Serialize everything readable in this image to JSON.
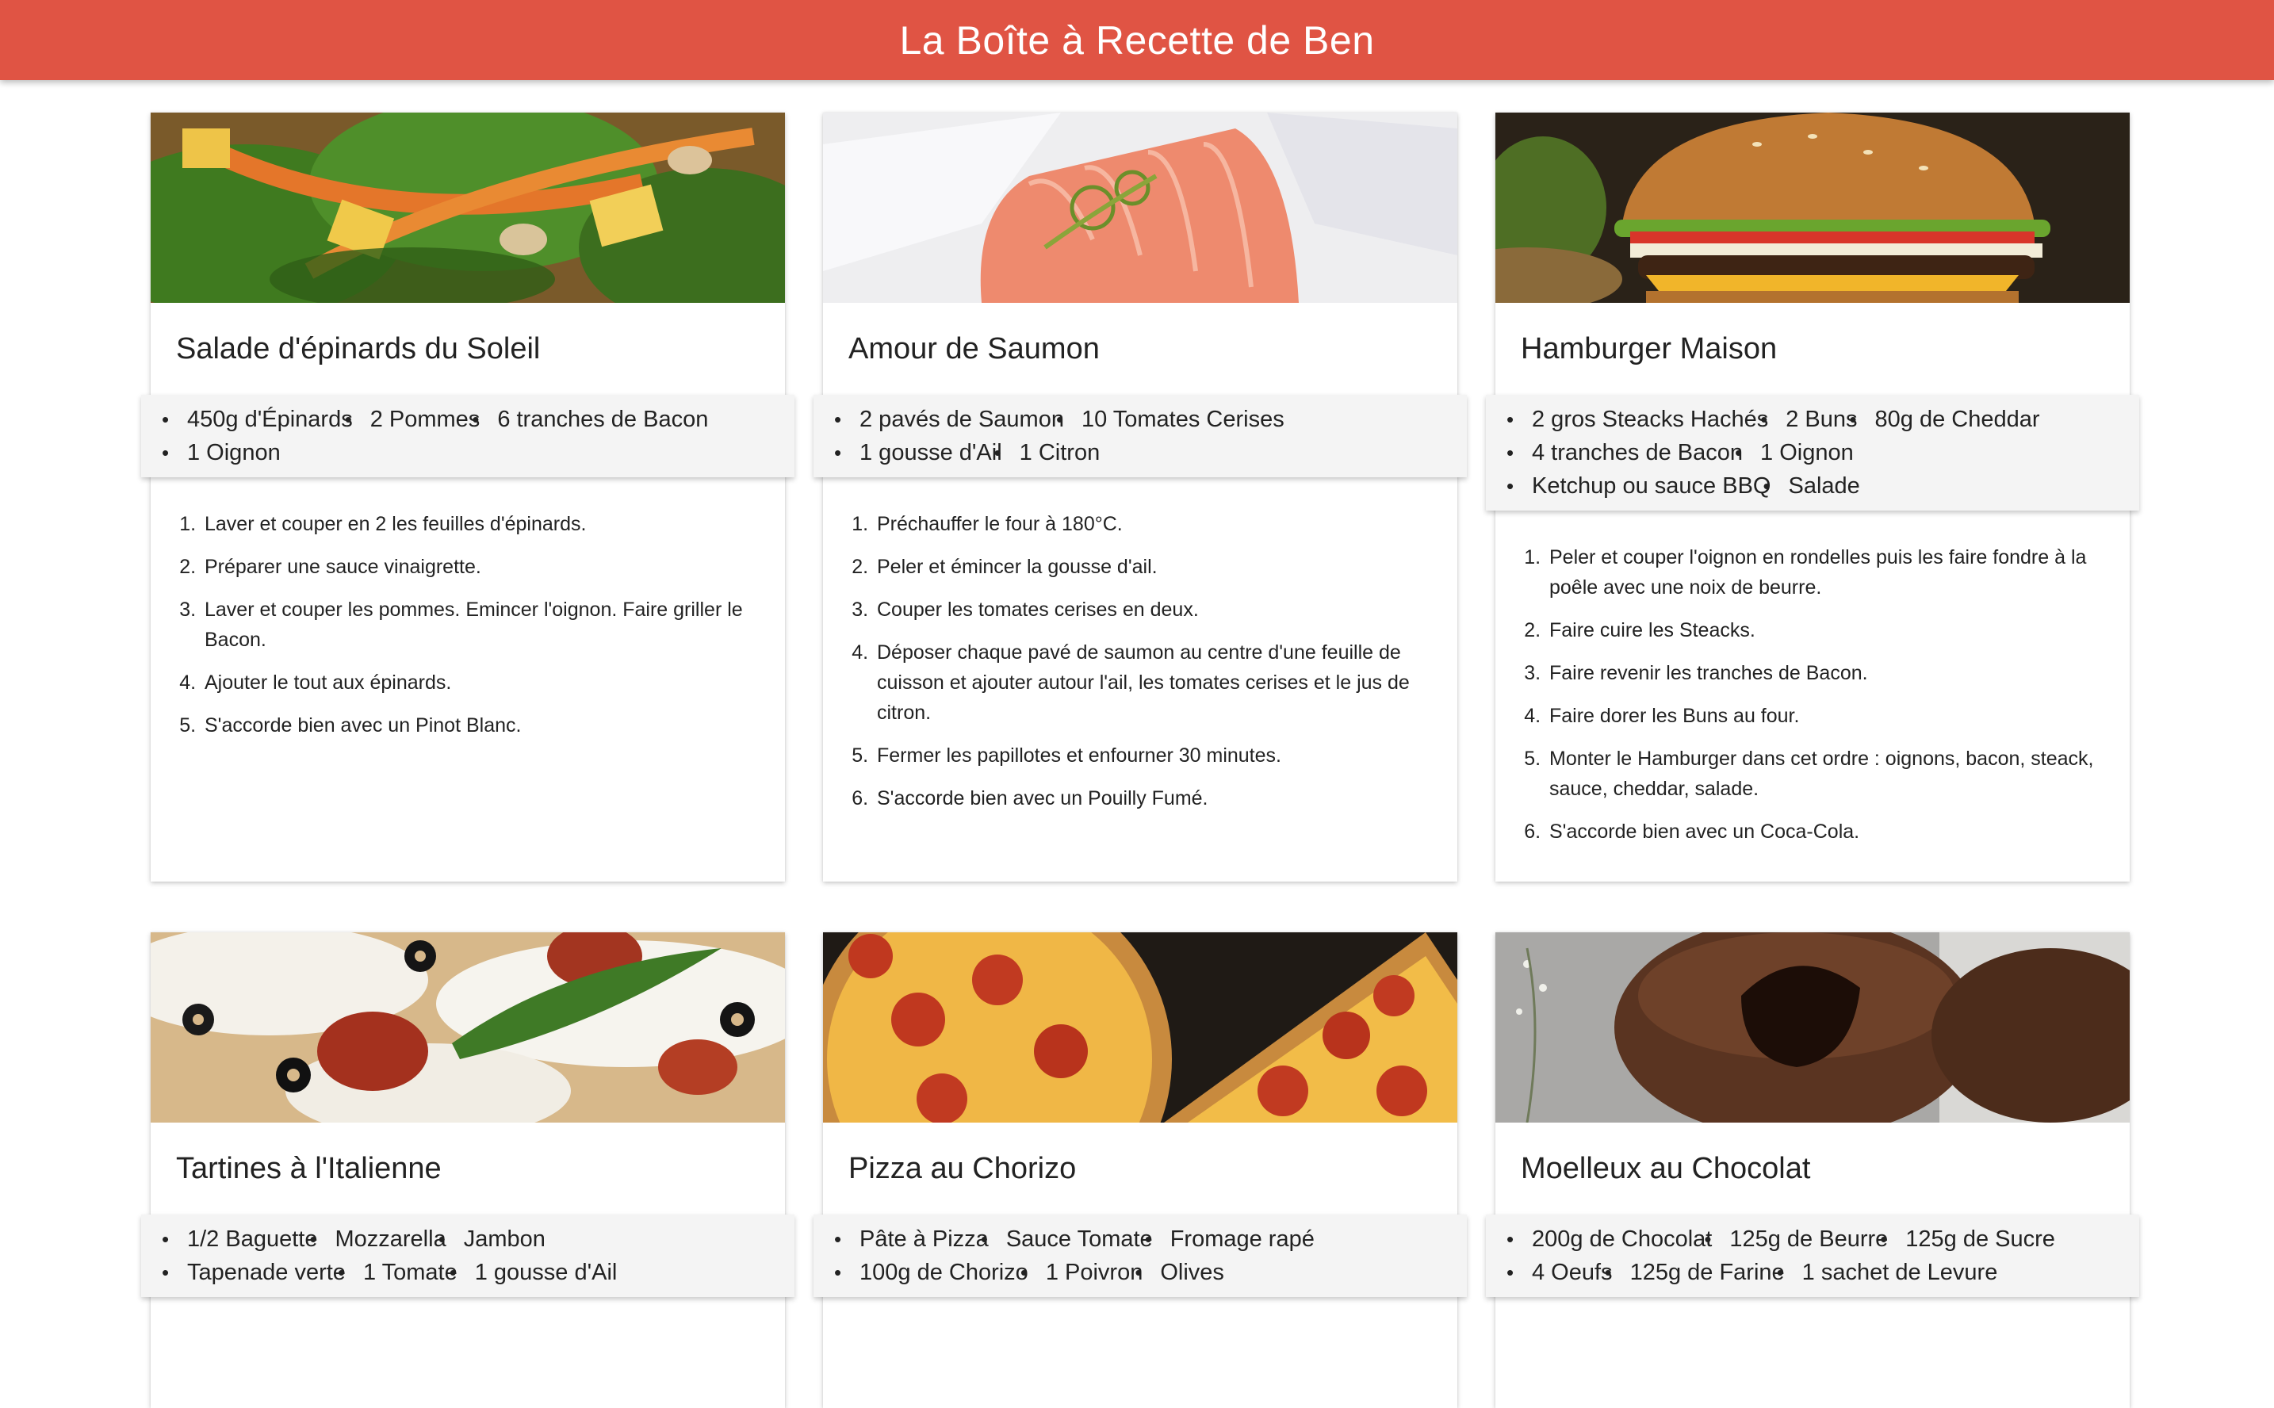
{
  "header": {
    "title": "La Boîte à Recette de Ben"
  },
  "recipes": [
    {
      "title": "Salade d'épinards du Soleil",
      "image": "spinach-salad-image",
      "ingredient_lines": [
        [
          "450g d'Épinards",
          "2 Pommes",
          "6 tranches de Bacon"
        ],
        [
          "1 Oignon"
        ]
      ],
      "steps": [
        "Laver et couper en 2 les feuilles d'épinards.",
        "Préparer une sauce vinaigrette.",
        "Laver et couper les pommes. Emincer l'oignon. Faire griller le Bacon.",
        "Ajouter le tout aux épinards.",
        "S'accorde bien avec un Pinot Blanc."
      ]
    },
    {
      "title": "Amour de Saumon",
      "image": "salmon-image",
      "ingredient_lines": [
        [
          "2 pavés de Saumon",
          "10 Tomates Cerises"
        ],
        [
          "1 gousse d'Ail",
          "1 Citron"
        ]
      ],
      "steps": [
        "Préchauffer le four à 180°C.",
        "Peler et émincer la gousse d'ail.",
        "Couper les tomates cerises en deux.",
        "Déposer chaque pavé de saumon au centre d'une feuille de cuisson et ajouter autour l'ail, les tomates cerises et le jus de citron.",
        "Fermer les papillotes et enfourner 30 minutes.",
        "S'accorde bien avec un Pouilly Fumé."
      ]
    },
    {
      "title": "Hamburger Maison",
      "image": "hamburger-image",
      "ingredient_lines": [
        [
          "2 gros Steacks Hachés",
          "2 Buns",
          "80g de Cheddar"
        ],
        [
          "4 tranches de Bacon",
          "1 Oignon"
        ],
        [
          "Ketchup ou sauce BBQ",
          "Salade"
        ]
      ],
      "steps": [
        "Peler et couper l'oignon en rondelles puis les faire fondre à la poêle avec une noix de beurre.",
        "Faire cuire les Steacks.",
        "Faire revenir les tranches de Bacon.",
        "Faire dorer les Buns au four.",
        "Monter le Hamburger dans cet ordre : oignons, bacon, steack, sauce, cheddar, salade.",
        "S'accorde bien avec un Coca-Cola."
      ]
    },
    {
      "title": "Tartines à l'Italienne",
      "image": "tartines-image",
      "ingredient_lines": [
        [
          "1/2 Baguette",
          "Mozzarella",
          "Jambon"
        ],
        [
          "Tapenade verte",
          "1 Tomate",
          "1 gousse d'Ail"
        ]
      ],
      "steps": []
    },
    {
      "title": "Pizza au Chorizo",
      "image": "pizza-image",
      "ingredient_lines": [
        [
          "Pâte à Pizza",
          "Sauce Tomate",
          "Fromage rapé"
        ],
        [
          "100g de Chorizo",
          "1 Poivron",
          "Olives"
        ]
      ],
      "steps": []
    },
    {
      "title": "Moelleux au Chocolat",
      "image": "chocolate-cake-image",
      "ingredient_lines": [
        [
          "200g de Chocolat",
          "125g de Beurre",
          "125g de Sucre"
        ],
        [
          "4 Oeufs",
          "125g de Farine",
          "1 sachet de Levure"
        ]
      ],
      "steps": []
    }
  ]
}
